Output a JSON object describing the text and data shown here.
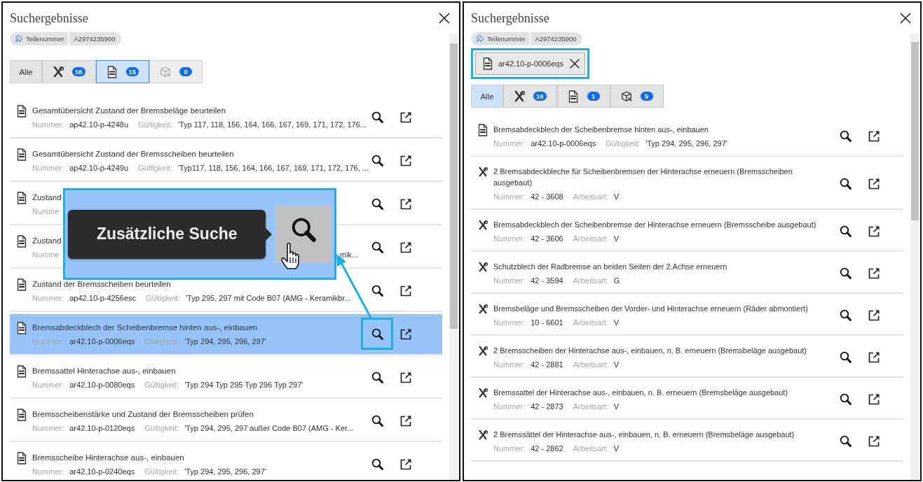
{
  "panels": [
    {
      "title": "Suchergebnisse",
      "chips": [
        {
          "label": "Teilenummer",
          "value": "A2974235900"
        }
      ],
      "tabs": [
        {
          "kind": "all",
          "label": "Alle",
          "selected": false,
          "disabled": false
        },
        {
          "kind": "repair",
          "count": "16",
          "selected": false,
          "disabled": false
        },
        {
          "kind": "wis",
          "count": "15",
          "selected": true,
          "disabled": false
        },
        {
          "kind": "parts",
          "count": "0",
          "selected": false,
          "disabled": true
        }
      ],
      "rows": [
        {
          "kind": "wis",
          "title": "Gesamtübersicht Zustand der Bremsbeläge beurteilen",
          "fields": [
            {
              "label": "Nummer:",
              "value": "ap42.10-p-4248u"
            },
            {
              "label": "Gültigkeit:",
              "value": "'Typ 117, 118, 156, 164, 166, 167, 169, 171, 172, 176..."
            }
          ],
          "selected": false,
          "search_highlighted": false
        },
        {
          "kind": "wis",
          "title": "Gesamtübersicht Zustand der Bremsscheiben beurteilen",
          "fields": [
            {
              "label": "Nummer:",
              "value": "ap42.10-p-4249u"
            },
            {
              "label": "Gültigkeit:",
              "value": "'Typ117, 118, 156, 164, 166, 167, 169, 171, 172, 176, ..."
            }
          ],
          "selected": false,
          "search_highlighted": false
        },
        {
          "kind": "wis",
          "title": "Zustand",
          "fields": [
            {
              "label": "Numme"
            }
          ],
          "selected": false,
          "search_highlighted": false
        },
        {
          "kind": "wis",
          "title": "Zustand",
          "fields": [
            {
              "label": "Numme"
            },
            {
              "value": "mik..."
            }
          ],
          "selected": false,
          "search_highlighted": false
        },
        {
          "kind": "wis",
          "title": "Zustand der Bremsscheiben beurteilen",
          "fields": [
            {
              "label": "Nummer:",
              "value": "ap42.10-p-4256esc"
            },
            {
              "label": "Gültigkeit:",
              "value": "'Typ 295, 297 mit Code B07 (AMG - Keramikbr..."
            }
          ],
          "selected": false,
          "search_highlighted": false
        },
        {
          "kind": "wis",
          "title": "Bremsabdeckblech der Scheibenbremse hinten aus-, einbauen",
          "fields": [
            {
              "label": "Nummer:",
              "value": "ar42.10-p-0006eqs"
            },
            {
              "label": "Gültigkeit:",
              "value": "'Typ 294, 295, 296, 297'"
            }
          ],
          "selected": true,
          "search_highlighted": true
        },
        {
          "kind": "wis",
          "title": "Bremssattel Hinterachse aus-, einbauen",
          "fields": [
            {
              "label": "Nummer:",
              "value": "ar42.10-p-0080eqs"
            },
            {
              "label": "Gültigkeit:",
              "value": "'Typ 294 Typ 295 Typ 296 Typ 297'"
            }
          ],
          "selected": false,
          "search_highlighted": false
        },
        {
          "kind": "wis",
          "title": "Bremsscheibenstärke und Zustand der Bremsscheiben prüfen",
          "fields": [
            {
              "label": "Nummer:",
              "value": "ar42.10-p-0120eqs"
            },
            {
              "label": "Gültigkeit:",
              "value": "'Typ 294, 295, 297 außer Code B07 (AMG - Ker..."
            }
          ],
          "selected": false,
          "search_highlighted": false
        },
        {
          "kind": "wis",
          "title": "Bremsscheibe Hinterachse aus-, einbauen",
          "fields": [
            {
              "label": "Nummer:",
              "value": "ar42.10-p-0240eqs"
            },
            {
              "label": "Gültigkeit:",
              "value": "'Typ 294, 295, 296, 297'"
            }
          ],
          "selected": false,
          "search_highlighted": false
        }
      ],
      "callout": {
        "text": "Zusätzliche Suche"
      }
    },
    {
      "title": "Suchergebnisse",
      "chips": [
        {
          "label": "Teilenummer",
          "value": "A2974235900"
        }
      ],
      "filter": {
        "text": "ar42.10-p-0006eqs",
        "highlighted": true
      },
      "tabs": [
        {
          "kind": "all",
          "label": "Alle",
          "selected": true,
          "disabled": false
        },
        {
          "kind": "repair",
          "count": "16",
          "selected": false,
          "disabled": false
        },
        {
          "kind": "wis",
          "count": "1",
          "selected": false,
          "disabled": false
        },
        {
          "kind": "parts",
          "count": "5",
          "selected": false,
          "disabled": false
        }
      ],
      "rows": [
        {
          "kind": "wis",
          "title": "Bremsabdeckblech der Scheibenbremse hinten aus-, einbauen",
          "fields": [
            {
              "label": "Nummer:",
              "value": "ar42.10-p-0006eqs"
            },
            {
              "label": "Gültigkeit:",
              "value": "'Typ 294, 295, 296, 297'"
            }
          ],
          "selected": false,
          "search_highlighted": false
        },
        {
          "kind": "repair",
          "title": "2 Bremsabdeckbleche für Scheibenbremsen der Hinterachse erneuern (Bremsscheiben ausgebaut)",
          "fields": [
            {
              "label": "Nummer:",
              "value": "42 - 3608"
            },
            {
              "label": "Arbeitsart:",
              "value": "V"
            }
          ],
          "selected": false,
          "search_highlighted": false
        },
        {
          "kind": "repair",
          "title": "Bremsabdeckblech der Scheibenbremse der Hinterachse erneuern (Bremsscheibe ausgebaut)",
          "fields": [
            {
              "label": "Nummer:",
              "value": "42 - 3606"
            },
            {
              "label": "Arbeitsart:",
              "value": "V"
            }
          ],
          "selected": false,
          "search_highlighted": false
        },
        {
          "kind": "repair",
          "title": "Schutzblech der Radbremse an beiden Seiten der 2.Achse erneuern",
          "fields": [
            {
              "label": "Nummer:",
              "value": "42 - 3594"
            },
            {
              "label": "Arbeitsart:",
              "value": "G"
            }
          ],
          "selected": false,
          "search_highlighted": false
        },
        {
          "kind": "repair",
          "title": "Bremsbeläge und Bremsscheiben der Vorder- und Hinterachse erneuern (Räder abmontiert)",
          "fields": [
            {
              "label": "Nummer:",
              "value": "10 - 6601"
            },
            {
              "label": "Arbeitsart:",
              "value": "V"
            }
          ],
          "selected": false,
          "search_highlighted": false
        },
        {
          "kind": "repair",
          "title": "2 Bremsscheiben der Hinterachse aus-, einbauen, n. B. erneuern (Bremsbeläge ausgebaut)",
          "fields": [
            {
              "label": "Nummer:",
              "value": "42 - 2881"
            },
            {
              "label": "Arbeitsart:",
              "value": "V"
            }
          ],
          "selected": false,
          "search_highlighted": false
        },
        {
          "kind": "repair",
          "title": "Bremssattel der Hinterachse aus-, einbauen, n. B. erneuern (Bremsbeläge ausgebaut)",
          "fields": [
            {
              "label": "Nummer:",
              "value": "42 - 2873"
            },
            {
              "label": "Arbeitsart:",
              "value": "V"
            }
          ],
          "selected": false,
          "search_highlighted": false
        },
        {
          "kind": "repair",
          "title": "2 Bremssättel der Hinterachse aus-, einbauen, n. B. erneuern (Bremsbeläge ausgebaut)",
          "fields": [
            {
              "label": "Nummer:",
              "value": "42 - 2862"
            },
            {
              "label": "Arbeitsart:",
              "value": "V"
            }
          ],
          "selected": false,
          "search_highlighted": false
        }
      ]
    }
  ]
}
